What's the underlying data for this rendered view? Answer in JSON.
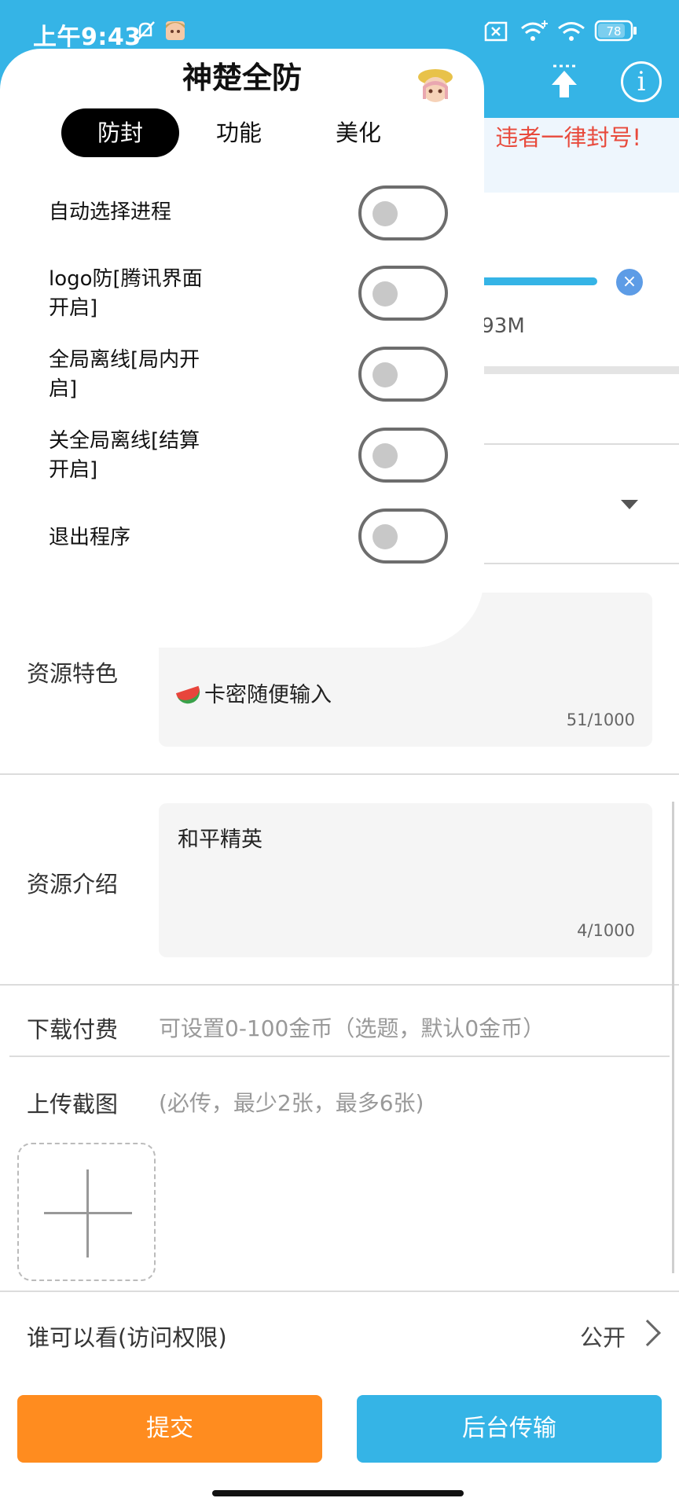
{
  "status_bar": {
    "time": "上午9:43",
    "battery": "78",
    "icons": [
      "mute-icon",
      "avatar-icon",
      "sim-off-icon",
      "wifi-plus-icon",
      "wifi-icon",
      "battery-icon"
    ]
  },
  "header": {
    "upload_icon": "upload-arrow-icon",
    "info_icon": "info-icon",
    "info_glyph": "i"
  },
  "background_form": {
    "notice": "违者一律封号!",
    "upload_size": ".93M",
    "cancel_glyph": "×",
    "features": {
      "label": "资源特色",
      "value": "卡密随便输入",
      "emoji": "watermelon-icon",
      "count": "51/1000"
    },
    "intro": {
      "label": "资源介绍",
      "value": "和平精英",
      "count": "4/1000"
    },
    "fee": {
      "label": "下载付费",
      "placeholder": "可设置0-100金币（选题，默认0金币）"
    },
    "screenshots": {
      "label": "上传截图",
      "hint": "(必传，最少2张，最多6张)"
    },
    "permission": {
      "label": "谁可以看(访问权限)",
      "value": "公开"
    },
    "buttons": {
      "submit": "提交",
      "background": "后台传输"
    }
  },
  "panel": {
    "title": "神楚全防",
    "tabs": [
      {
        "label": "防封",
        "active": true
      },
      {
        "label": "功能",
        "active": false
      },
      {
        "label": "美化",
        "active": false
      }
    ],
    "options": [
      {
        "label": "自动选择进程",
        "enabled": false
      },
      {
        "label": "logo防[腾讯界面开启]",
        "enabled": false
      },
      {
        "label": "全局离线[局内开启]",
        "enabled": false
      },
      {
        "label": "关全局离线[结算开启]",
        "enabled": false
      },
      {
        "label": "退出程序",
        "enabled": false
      }
    ]
  },
  "colors": {
    "header_blue": "#35b4e6",
    "submit_orange": "#ff8c1f",
    "notice_red": "#e84a3c"
  }
}
